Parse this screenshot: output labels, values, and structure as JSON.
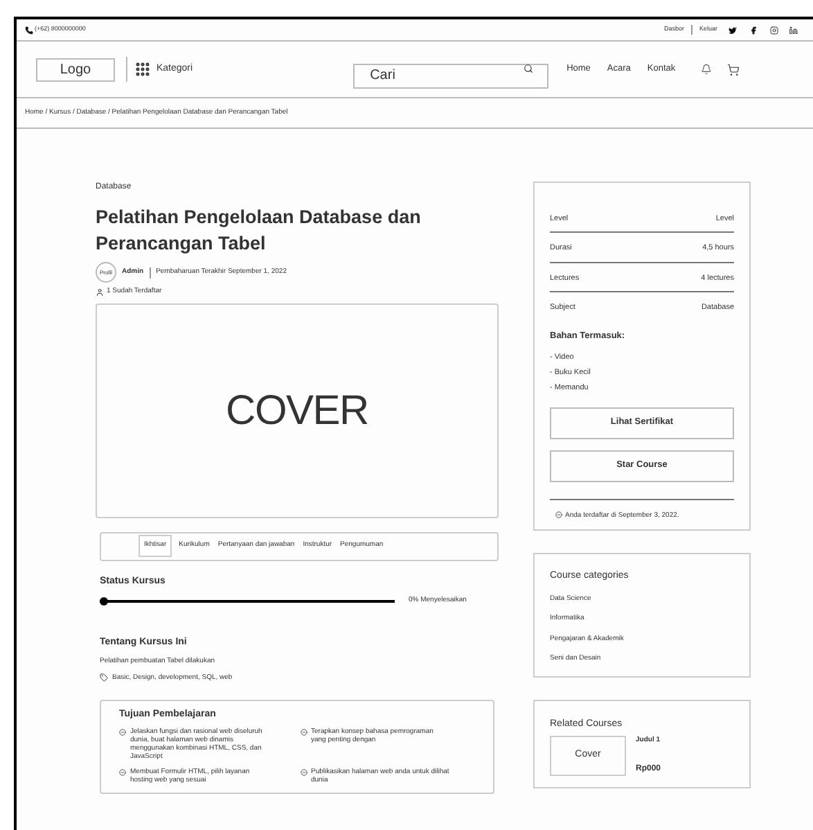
{
  "topbar": {
    "phone": "(+62) 8000000000",
    "links": [
      "Dasbor",
      "Keluar"
    ]
  },
  "header": {
    "logo": "Logo",
    "category": "Kategori",
    "search": {
      "placeholder": "Cari"
    },
    "nav": [
      "Home",
      "Acara",
      "Kontak"
    ]
  },
  "breadcrumb": "Home / Kursus / Database / Pelatihan Pengelolaan Database dan Perancangan Tabel",
  "course": {
    "category": "Database",
    "title": "Pelatihan Pengelolaan Database dan Perancangan Tabel",
    "avatar": "Profil",
    "author": "Admin",
    "updated": "Pembaharuan Terakhir September 1, 2022",
    "enrolled": "1 Sudah Terdaftar",
    "cover": "COVER"
  },
  "tabs": [
    {
      "label": "Ikhtisar",
      "selected": true
    },
    {
      "label": "Kurikulum",
      "selected": false
    },
    {
      "label": "Pertanyaan dan jawaban",
      "selected": false
    },
    {
      "label": "Instruktur",
      "selected": false
    },
    {
      "label": "Pengumuman",
      "selected": false
    }
  ],
  "status": {
    "title": "Status Kursus",
    "level": 0,
    "reading": "0% Menyelesaikan"
  },
  "about": {
    "title": "Tentang Kursus Ini",
    "text": "Pelatihan pembuatan Tabel dilakukan",
    "tags": "Basic, Design, development, SQL, web"
  },
  "goals": {
    "title": "Tujuan Pembelajaran",
    "items": [
      "Jelaskan fungsi dan rasional web diseluruh dunia, buat halaman web dinamis menggunakan kombinasi HTML, CSS, dan JavaScript",
      "Terapkan konsep bahasa pemrograman yang penting dengan",
      "Membuat Formulir HTML, pilih layanan hosting web yang sesuai",
      "Publikasikan halaman web anda untuk dilihat dunia"
    ]
  },
  "info": {
    "rows": [
      {
        "label": "Level",
        "value": "Level"
      },
      {
        "label": "Durasi",
        "value": "4,5 hours"
      },
      {
        "label": "Lectures",
        "value": "4 lectures"
      },
      {
        "label": "Subject",
        "value": "Database"
      }
    ],
    "includes_title": "Bahan Termasuk:",
    "includes": [
      "- Video",
      "- Buku Kecil",
      "- Memandu"
    ],
    "buttons": [
      "Lihat Sertifikat",
      "Star Course"
    ],
    "enrolled_note": "Anda terdaftar di September 3, 2022."
  },
  "categories": {
    "title": "Course categories",
    "items": [
      "Data Science",
      "Informatika",
      "Pengajaran & Akademik",
      "Seni dan Desain"
    ]
  },
  "related": {
    "title": "Related Courses",
    "items": [
      {
        "cover": "Cover",
        "title": "Judul 1",
        "price": "Rp000"
      }
    ]
  }
}
